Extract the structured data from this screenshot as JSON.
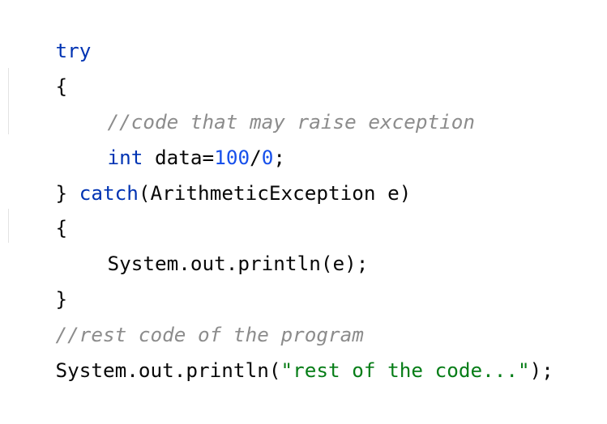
{
  "editor": {
    "lines": [
      {
        "tokens": [
          {
            "t": "try",
            "kind": "keyword"
          }
        ]
      },
      {
        "tokens": [
          {
            "t": "{",
            "kind": "plain"
          }
        ]
      },
      {
        "tokens": [
          {
            "t": "//code that may raise exception",
            "kind": "comment"
          }
        ]
      },
      {
        "tokens": [
          {
            "t": "int",
            "kind": "keyword"
          },
          {
            "t": " data=",
            "kind": "plain"
          },
          {
            "t": "100",
            "kind": "number"
          },
          {
            "t": "/",
            "kind": "plain"
          },
          {
            "t": "0",
            "kind": "number"
          },
          {
            "t": ";",
            "kind": "plain"
          }
        ]
      },
      {
        "tokens": [
          {
            "t": "} ",
            "kind": "plain"
          },
          {
            "t": "catch",
            "kind": "keyword"
          },
          {
            "t": "(ArithmeticException e)",
            "kind": "plain"
          }
        ]
      },
      {
        "tokens": [
          {
            "t": "{",
            "kind": "plain"
          }
        ]
      },
      {
        "tokens": [
          {
            "t": "System.out.println(e);",
            "kind": "plain"
          }
        ]
      },
      {
        "tokens": [
          {
            "t": "}",
            "kind": "plain"
          }
        ]
      },
      {
        "tokens": [
          {
            "t": "//rest code of the program",
            "kind": "comment"
          }
        ]
      },
      {
        "tokens": [
          {
            "t": "System.out.println(",
            "kind": "plain"
          },
          {
            "t": "\"rest of the code...\"",
            "kind": "string"
          },
          {
            "t": ");",
            "kind": "plain"
          }
        ]
      }
    ],
    "colors": {
      "keyword": "#0033b3",
      "number": "#1750eb",
      "string": "#067d17",
      "comment": "#8c8c8c",
      "plain": "#080808",
      "background": "#ffffff"
    }
  }
}
